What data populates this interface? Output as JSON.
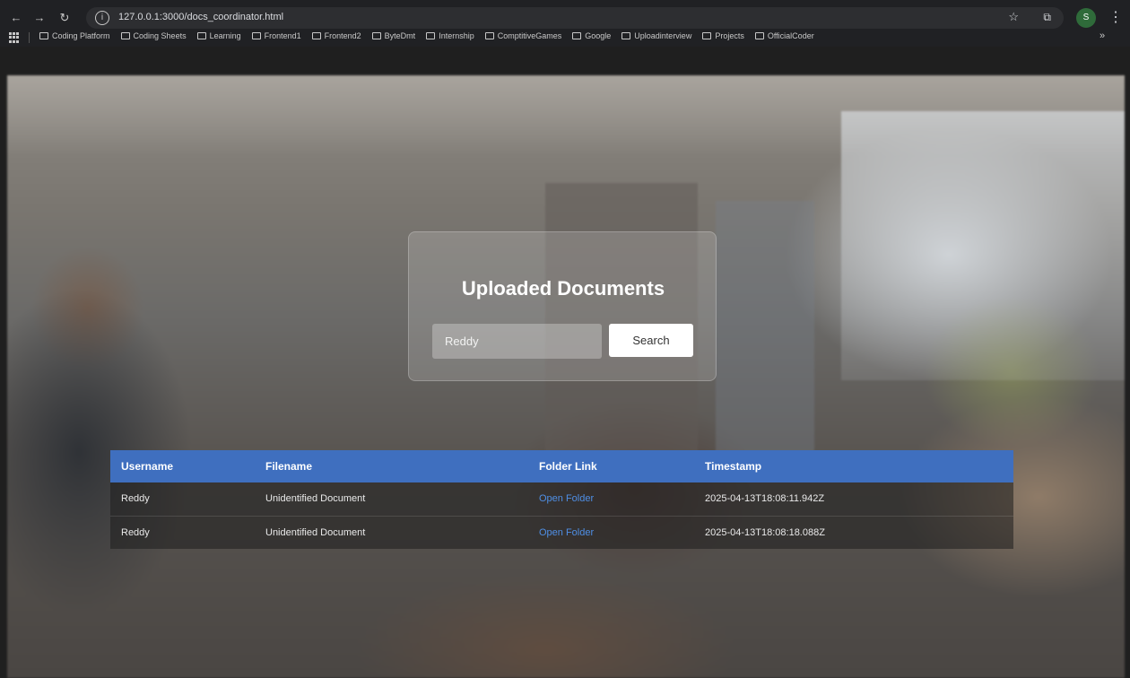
{
  "browser": {
    "url": "127.0.0.1:3000/docs_coordinator.html",
    "profile_initial": "S",
    "bookmarks": [
      "Coding Platform",
      "Coding Sheets",
      "Learning",
      "Frontend1",
      "Frontend2",
      "ByteDmt",
      "Internship",
      "ComptitiveGames",
      "Google",
      "Uploadinterview",
      "Projects",
      "OfficialCoder"
    ]
  },
  "page": {
    "title": "Uploaded Documents",
    "search": {
      "value": "Reddy",
      "button_label": "Search"
    }
  },
  "table": {
    "headers": [
      "Username",
      "Filename",
      "Folder Link",
      "Timestamp"
    ],
    "rows": [
      {
        "username": "Reddy",
        "filename": "Unidentified Document",
        "folder_link": "Open Folder",
        "timestamp": "2025-04-13T18:08:11.942Z"
      },
      {
        "username": "Reddy",
        "filename": "Unidentified Document",
        "folder_link": "Open Folder",
        "timestamp": "2025-04-13T18:08:18.088Z"
      }
    ]
  },
  "colors": {
    "table_header": "#3f6fbf",
    "link": "#4f8fe6",
    "card_bg": "rgba(255,255,255,0.16)"
  }
}
